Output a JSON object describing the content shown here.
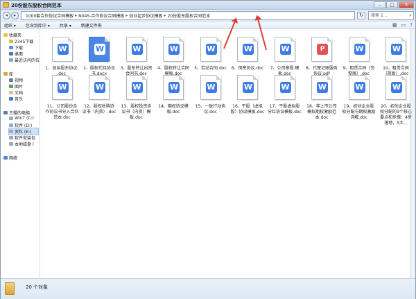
{
  "window": {
    "title": "20份股东股权合同范本",
    "controls": {
      "min": "–",
      "max": "□",
      "close": "✕"
    }
  },
  "address": {
    "crumbs": [
      "1000套合作协议合同模板",
      "N045-合作协议合同模板",
      "创业起步协议模板",
      "20份股东股权合同范本"
    ],
    "separator": "▸",
    "search_placeholder": "搜索 2..."
  },
  "toolbar": {
    "organize": "组织 ▾",
    "include_library": "包含到库中 ▾",
    "share": "共享 ▾",
    "new_folder": "新建文件夹"
  },
  "sidebar": {
    "favorites": "收藏夹",
    "fav_items": [
      "2345下载",
      "下载",
      "桌面",
      "最近访问的位"
    ],
    "libraries": "库",
    "lib_items": [
      "视频",
      "图片",
      "文档",
      "音乐"
    ],
    "computer": "王樱的电脑",
    "drives": [
      "Win7 (C:)",
      "软件 (D:)",
      "资料 (E:)",
      "软件安装包",
      "本地磁盘 ("
    ],
    "network": "网络"
  },
  "files": [
    {
      "name": "1、创始股东协议.doc",
      "type": "doc"
    },
    {
      "name": "2、股权代持协议书.docx",
      "type": "blue"
    },
    {
      "name": "3、股东转让出资合同书.doc",
      "type": "doc"
    },
    {
      "name": "4、股权转让合同模板.doc",
      "type": "doc"
    },
    {
      "name": "5、劳动合同.doc",
      "type": "doc"
    },
    {
      "name": "6、保密协议.doc",
      "type": "doc"
    },
    {
      "name": "7、公司章程 模板.doc",
      "type": "doc"
    },
    {
      "name": "8、代理记账服务协议.pdf",
      "type": "pdf"
    },
    {
      "name": "9、租赁合同（完整版）.doc",
      "type": "doc"
    },
    {
      "name": "10、租赁合同（简版）.doc",
      "type": "doc"
    },
    {
      "name": "11、公司股份合作协议书分入合伙范本.doc",
      "type": "doc"
    },
    {
      "name": "12、股权收购协议书（内资）.doc",
      "type": "doc"
    },
    {
      "name": "13、股权投资协议书（内资）模板.doc",
      "type": "doc"
    },
    {
      "name": "14、期权协议模板.doc",
      "type": "doc"
    },
    {
      "name": "15、一致行动协议.doc",
      "type": "doc"
    },
    {
      "name": "16、干股（虚拟股）协议模板.doc",
      "type": "doc"
    },
    {
      "name": "17、干股虚拟股分红协议模板.doc",
      "type": "doc"
    },
    {
      "name": "18、非上市公司模拟期权激励范本.doc",
      "type": "doc"
    },
    {
      "name": "19、初创企业股权分配与期权激励详解.doc",
      "type": "doc"
    },
    {
      "name": "20、初创企业股权分配的9个核心要点和步骤：4步落地，5大...",
      "type": "doc"
    }
  ],
  "status": {
    "count": "20 个对象"
  }
}
